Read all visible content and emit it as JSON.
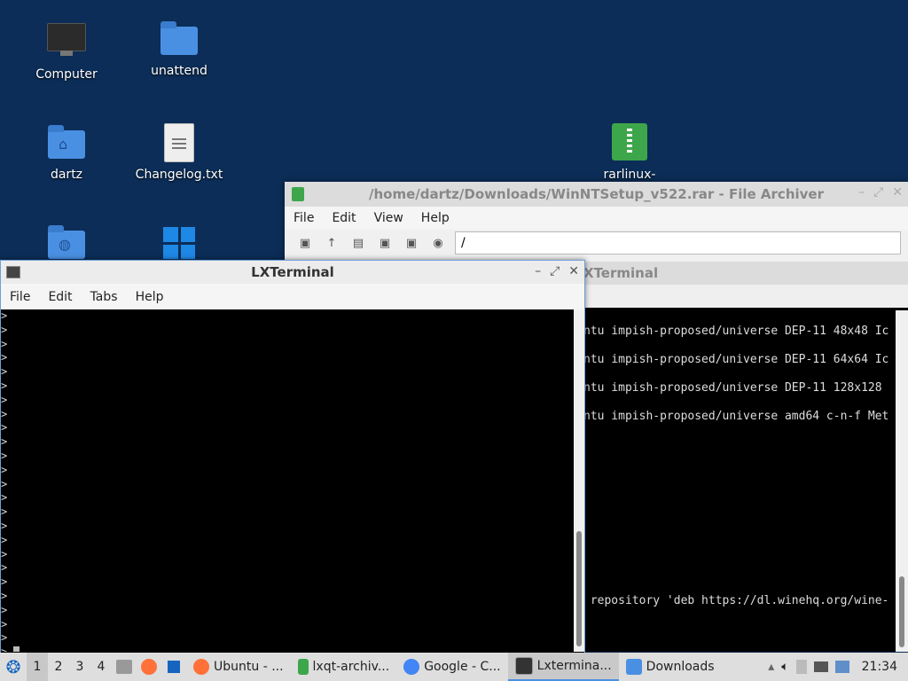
{
  "desktop": {
    "icons": [
      {
        "label": "Computer"
      },
      {
        "label": "unattend"
      },
      {
        "label": "dartz"
      },
      {
        "label": "Changelog.txt"
      },
      {
        "label": "rarlinux-"
      }
    ]
  },
  "archiver": {
    "title": "/home/dartz/Downloads/WinNTSetup_v522.rar - File Archiver",
    "menu": [
      "File",
      "Edit",
      "View",
      "Help"
    ],
    "path": "/"
  },
  "back_terminal": {
    "title": "XTerminal",
    "lines": [
      "ntu impish-proposed/universe DEP-11 48x48 Ic",
      "ntu impish-proposed/universe DEP-11 64x64 Ic",
      "ntu impish-proposed/universe DEP-11 128x128",
      "ntu impish-proposed/universe amd64 c-n-f Met",
      " repository 'deb https://dl.winehq.org/wine-"
    ]
  },
  "front_terminal": {
    "title": "LXTerminal",
    "menu": [
      "File",
      "Edit",
      "Tabs",
      "Help"
    ],
    "prompt_char": ">"
  },
  "taskbar": {
    "workspaces": [
      "1",
      "2",
      "3",
      "4"
    ],
    "tasks": [
      {
        "label": "Ubuntu - ...",
        "color": "#ff7139"
      },
      {
        "label": "lxqt-archiv...",
        "color": "#3ea64a"
      },
      {
        "label": "Google - C...",
        "color": "#4285f4"
      },
      {
        "label": "Lxtermina...",
        "color": "#333333"
      },
      {
        "label": "Downloads",
        "color": "#4a90e2"
      }
    ],
    "clock": "21:34"
  }
}
